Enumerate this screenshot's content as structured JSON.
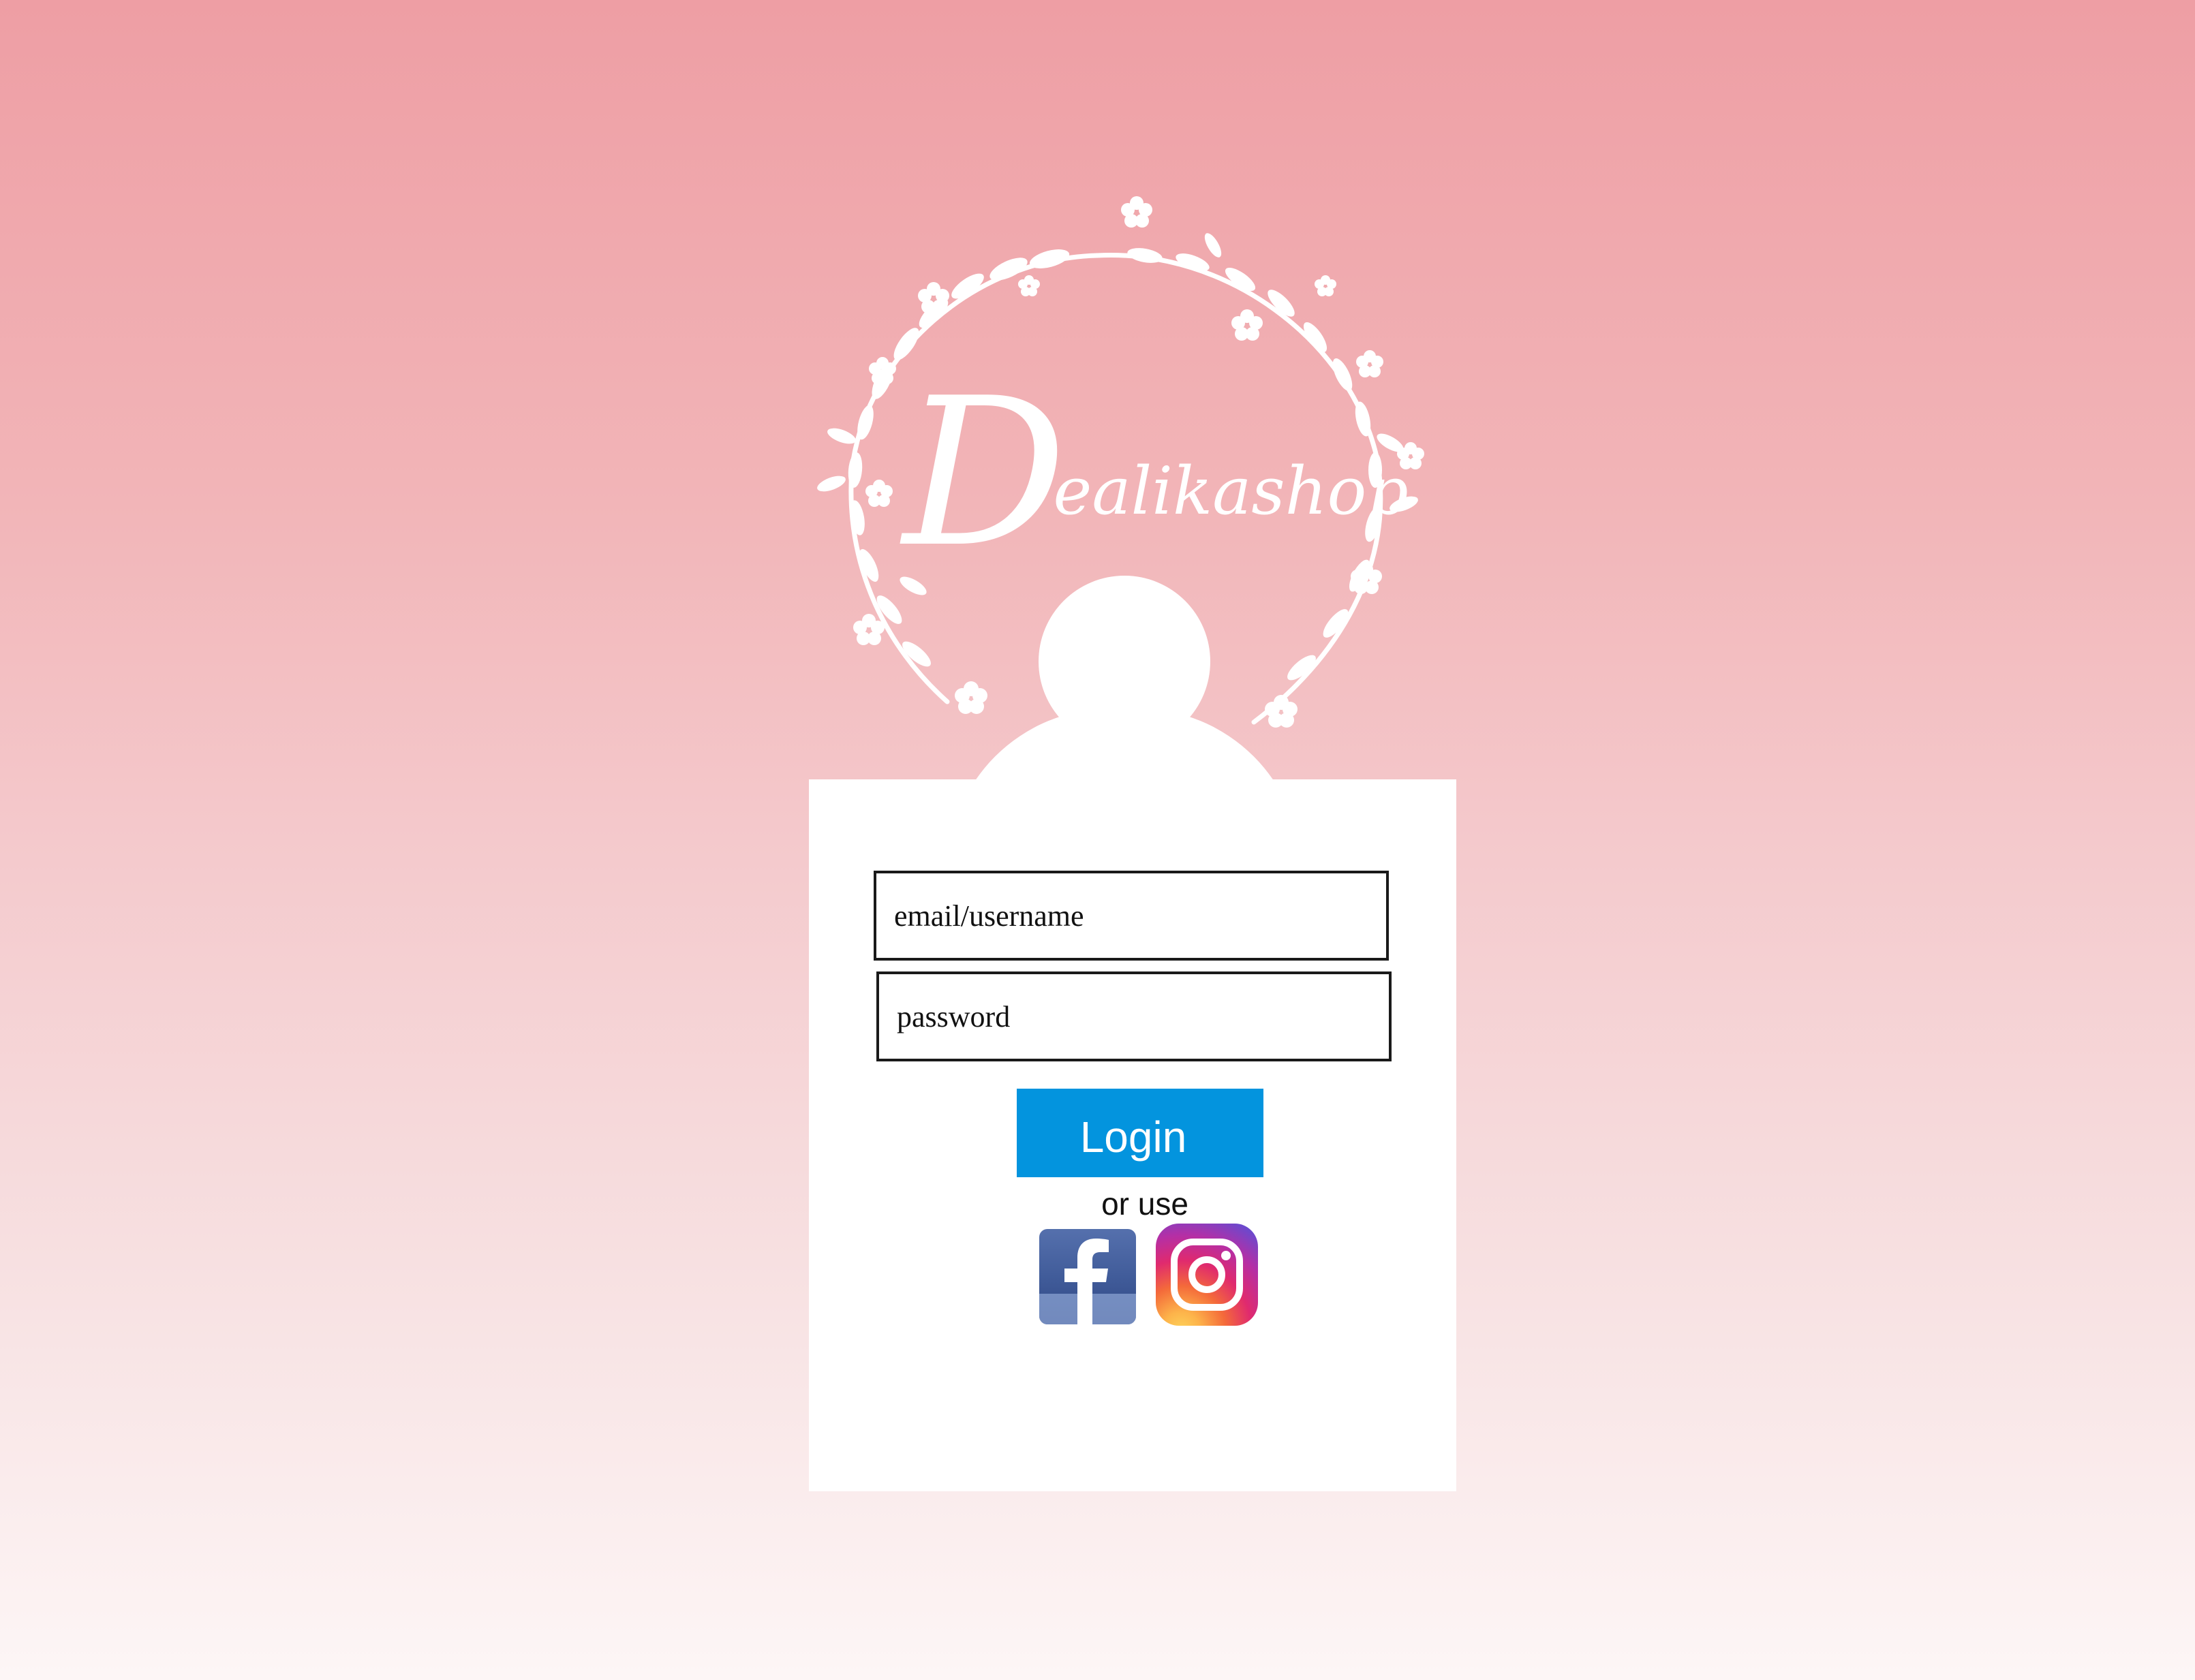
{
  "brand": {
    "name": "Dealikashop",
    "initial": "D",
    "rest": "ealikashop"
  },
  "login_form": {
    "email_placeholder": "email/username",
    "password_placeholder": "password",
    "login_label": "Login",
    "alt_text": "or use"
  },
  "social": [
    {
      "name": "facebook",
      "icon": "facebook-icon",
      "color": "#3b5998"
    },
    {
      "name": "instagram",
      "icon": "instagram-icon",
      "color": "#c13584"
    }
  ],
  "colors": {
    "background_top": "#ee9ea4",
    "background_bottom": "#fdf6f6",
    "accent": "#0394de",
    "card": "#ffffff"
  }
}
